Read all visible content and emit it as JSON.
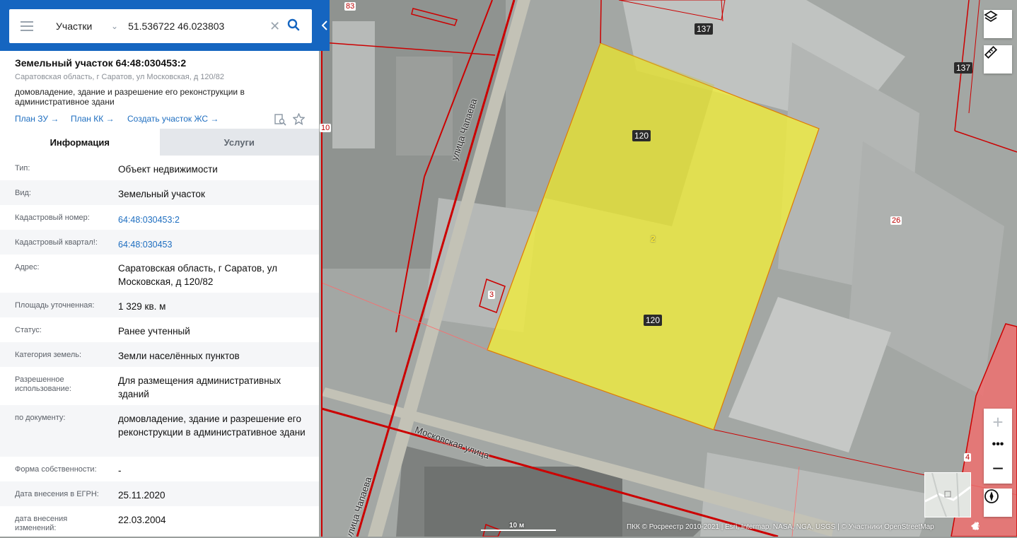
{
  "search": {
    "layer_select": "Участки",
    "query": "51.536722 46.023803"
  },
  "card": {
    "title": "Земельный участок 64:48:030453:2",
    "address": "Саратовская область, г Саратов, ул Московская, д 120/82",
    "description": "домовладение, здание и разрешение его реконструкции в административное здани",
    "links": [
      "План ЗУ →",
      "План КК →",
      "Создать участок ЖС →"
    ]
  },
  "tabs": {
    "info": "Информация",
    "services": "Услуги"
  },
  "rows": [
    {
      "label": "Тип:",
      "value": "Объект недвижимости"
    },
    {
      "label": "Вид:",
      "value": "Земельный участок"
    },
    {
      "label": "Кадастровый номер:",
      "value": "64:48:030453:2"
    },
    {
      "label": "Кадастровый квартал!:",
      "value": "64:48:030453"
    },
    {
      "label": "Адрес:",
      "value": "Саратовская область, г Саратов, ул Московская, д 120/82"
    },
    {
      "label": "Площадь уточненная:",
      "value": "1 329 кв. м"
    },
    {
      "label": "Статус:",
      "value": "Ранее учтенный"
    },
    {
      "label": "Категория земель:",
      "value": "Земли населённых пунктов"
    },
    {
      "label": "Разрешенное использование:",
      "value": "Для размещения административных зданий"
    },
    {
      "label": "по документу:",
      "value": "домовладение, здание и разрешение его реконструкции в административное здани"
    },
    {
      "label": "Форма собственности:",
      "value": "-"
    },
    {
      "label": "Дата внесения в ЕГРН:",
      "value": "25.11.2020"
    },
    {
      "label": "дата внесения изменений:",
      "value": "22.03.2004"
    }
  ],
  "map": {
    "labels": {
      "n83": "83",
      "n137a": "137",
      "n137b": "137",
      "n10": "10",
      "n120a": "120",
      "n120b": "120",
      "n2": "2",
      "n26": "26",
      "n3": "3",
      "n4": "4"
    },
    "streets": {
      "chapaeva_top": "улица Чапаева",
      "chapaeva_bottom": "улица Чапаева",
      "moskovskaya": "Московская улица"
    },
    "scale": "10 м",
    "attribution": "ПКК © Росреестр 2010-2021 | Esri, Intermap, NASA, NGA, USGS | © Участники OpenStreetMap",
    "zoom_more": "•••",
    "colors": {
      "parcel_fill": "#f2ee3a",
      "boundary": "#d40000",
      "topbar": "#1565c0",
      "link": "#1e6ec0"
    }
  }
}
